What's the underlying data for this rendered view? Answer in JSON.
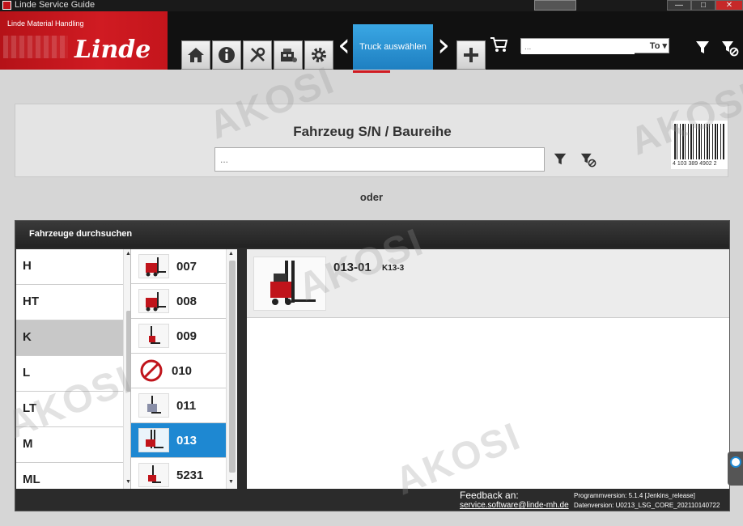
{
  "window": {
    "title": "Linde Service Guide",
    "buttons": {
      "minimize": "—",
      "maximize": "□",
      "close": "✕"
    }
  },
  "header": {
    "logo_subtitle": "Linde Material Handling",
    "logo_brand": "Linde",
    "nav_icons": [
      "home-icon",
      "info-icon",
      "tools-icon",
      "machine-icon",
      "settings-icon"
    ],
    "active_tab": "Truck auswählen",
    "search": {
      "placeholder": "...",
      "selector": "To"
    },
    "accent_color": "#1e88d2",
    "brand_color": "#d01b22"
  },
  "serial_search": {
    "label": "Fahrzeug S/N / Baureihe",
    "placeholder": "...",
    "barcode_number": "4 103 389 4902 2"
  },
  "separator": "oder",
  "browse": {
    "title": "Fahrzeuge durchsuchen",
    "letters": [
      "H",
      "HT",
      "K",
      "L",
      "LT",
      "M",
      "ML"
    ],
    "selected_letter": "K",
    "models": [
      {
        "num": "007",
        "forbidden": false
      },
      {
        "num": "008",
        "forbidden": false
      },
      {
        "num": "009",
        "forbidden": false
      },
      {
        "num": "010",
        "forbidden": true
      },
      {
        "num": "011",
        "forbidden": false
      },
      {
        "num": "013",
        "forbidden": false
      },
      {
        "num": "5231",
        "forbidden": false
      }
    ],
    "selected_model": "013",
    "variants": [
      {
        "code": "013-01",
        "type": "K13-3"
      }
    ]
  },
  "footer": {
    "feedback_label": "Feedback an:",
    "feedback_email": "service.software@linde-mh.de",
    "program_version": "Programmversion: 5.1.4 [Jenkins_release]",
    "data_version": "Datenversion: U0213_LSG_CORE_202110140722"
  },
  "watermark": "AKOSI"
}
